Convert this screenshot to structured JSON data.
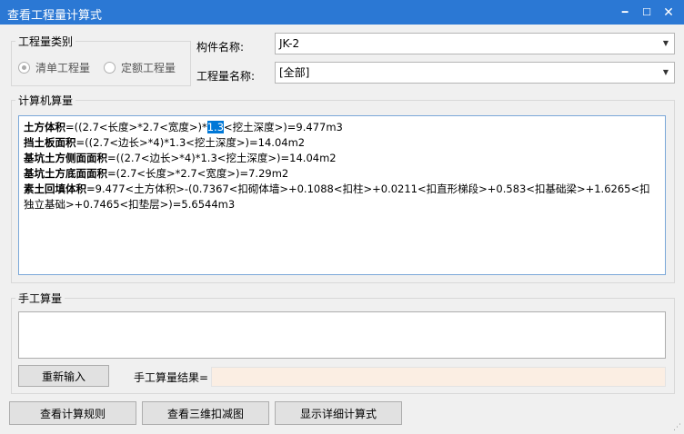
{
  "window": {
    "title": "查看工程量计算式"
  },
  "category": {
    "label": "工程量类别",
    "options": [
      {
        "label": "清单工程量",
        "selected": true
      },
      {
        "label": "定额工程量",
        "selected": false
      }
    ]
  },
  "component": {
    "label": "构件名称:",
    "value": "JK-2"
  },
  "quantity_name": {
    "label": "工程量名称:",
    "value": "[全部]"
  },
  "computer_calc": {
    "label": "计算机算量",
    "lines": [
      {
        "name": "土方体积",
        "pre": "=((2.7<长度>*2.7<宽度>)*",
        "highlight": "1.3",
        "post": "<挖土深度>)=9.477m3"
      },
      {
        "name": "挡土板面积",
        "text": "=((2.7<边长>*4)*1.3<挖土深度>)=14.04m2"
      },
      {
        "name": "基坑土方侧面面积",
        "text": "=((2.7<边长>*4)*1.3<挖土深度>)=14.04m2"
      },
      {
        "name": "基坑土方底面面积",
        "text": "=(2.7<长度>*2.7<宽度>)=7.29m2"
      },
      {
        "name": "素土回填体积",
        "text": "=9.477<土方体积>-(0.7367<扣砌体墙>+0.1088<扣柱>+0.0211<扣直形梯段>+0.583<扣基础梁>+1.6265<扣独立基础>+0.7465<扣垫层>)=5.6544m3"
      }
    ]
  },
  "manual_calc": {
    "label": "手工算量",
    "input_value": "",
    "reset_label": "重新输入",
    "result_label": "手工算量结果=",
    "result_value": ""
  },
  "footer": {
    "rules_button": "查看计算规则",
    "view3d_button": "查看三维扣减图",
    "detail_button": "显示详细计算式"
  }
}
